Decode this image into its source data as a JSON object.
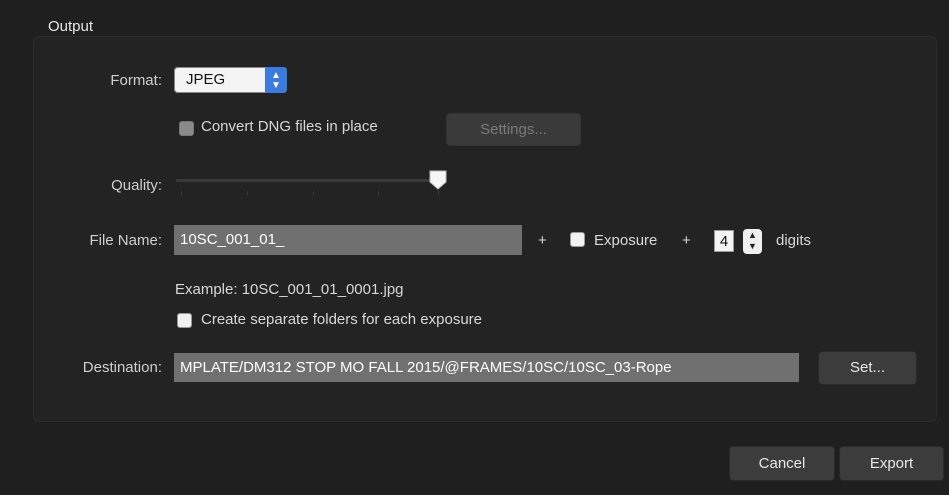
{
  "group": {
    "title": "Output"
  },
  "format": {
    "label": "Format:",
    "value": "JPEG",
    "arrows_icon": "chevron-up-down-icon"
  },
  "convert_dng": {
    "label": "Convert DNG files in place",
    "checked": false,
    "enabled": false
  },
  "settings_button": {
    "label": "Settings...",
    "enabled": false
  },
  "quality": {
    "label": "Quality:",
    "value_fraction": 1.0,
    "tick_count": 5
  },
  "file_name": {
    "label": "File Name:",
    "value": "10SC_001_01_",
    "plus_1": "+",
    "exposure_label": "Exposure",
    "exposure_checked": false,
    "plus_2": "+",
    "digits_value": "4",
    "digits_label": "digits"
  },
  "example": {
    "text": "Example: 10SC_001_01_0001.jpg"
  },
  "separate_folders": {
    "label": "Create separate folders for each exposure",
    "checked": false
  },
  "destination": {
    "label": "Destination:",
    "value": "MPLATE/DM312 STOP MO FALL 2015/@FRAMES/10SC/10SC_03-Rope",
    "set_label": "Set..."
  },
  "footer": {
    "cancel_label": "Cancel",
    "export_label": "Export"
  }
}
